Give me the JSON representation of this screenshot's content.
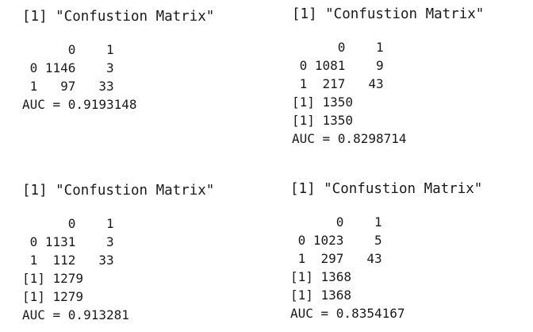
{
  "colors": {
    "text": "#1a1a1a",
    "background": "#ffffff"
  },
  "panels": [
    {
      "title": "[1] \"Confustion Matrix\"",
      "lines": [
        "      0    1",
        " 0 1146    3",
        " 1   97   33",
        "AUC = 0.9193148"
      ]
    },
    {
      "title": "[1] \"Confustion Matrix\"",
      "lines": [
        "      0    1",
        " 0 1081    9",
        " 1  217   43",
        "[1] 1350",
        "[1] 1350",
        "AUC = 0.8298714"
      ]
    },
    {
      "title": "[1] \"Confustion Matrix\"",
      "lines": [
        "      0    1",
        " 0 1131    3",
        " 1  112   33",
        "[1] 1279",
        "[1] 1279",
        "AUC = 0.913281"
      ]
    },
    {
      "title": "[1] \"Confustion Matrix\"",
      "lines": [
        "      0    1",
        " 0 1023    5",
        " 1  297   43",
        "[1] 1368",
        "[1] 1368",
        "AUC = 0.8354167"
      ]
    }
  ]
}
